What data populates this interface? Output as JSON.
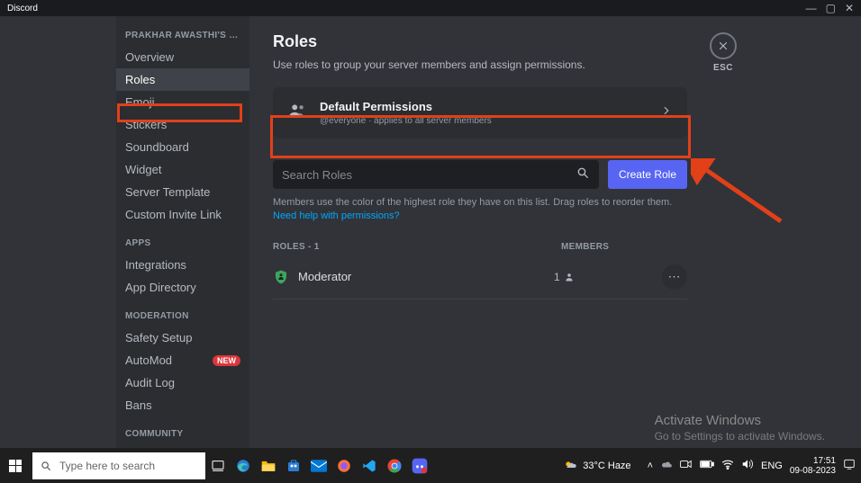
{
  "titlebar": {
    "app_name": "Discord"
  },
  "sidebar": {
    "server_heading": "PRAKHAR AWASTHI'S SERV…",
    "items": [
      {
        "label": "Overview"
      },
      {
        "label": "Roles",
        "selected": true
      },
      {
        "label": "Emoji"
      },
      {
        "label": "Stickers"
      },
      {
        "label": "Soundboard"
      },
      {
        "label": "Widget"
      },
      {
        "label": "Server Template"
      },
      {
        "label": "Custom Invite Link"
      }
    ],
    "apps_heading": "APPS",
    "apps": [
      {
        "label": "Integrations"
      },
      {
        "label": "App Directory"
      }
    ],
    "moderation_heading": "MODERATION",
    "moderation": [
      {
        "label": "Safety Setup"
      },
      {
        "label": "AutoMod",
        "badge": "NEW"
      },
      {
        "label": "Audit Log"
      },
      {
        "label": "Bans"
      }
    ],
    "community_heading": "COMMUNITY"
  },
  "main": {
    "title": "Roles",
    "description": "Use roles to group your server members and assign permissions.",
    "esc_label": "ESC",
    "default_card": {
      "title": "Default Permissions",
      "sub": "@everyone · applies to all server members"
    },
    "search_placeholder": "Search Roles",
    "create_button": "Create Role",
    "help_prefix": "Members use the color of the highest role they have on this list. Drag roles to reorder them. ",
    "help_link": "Need help with permissions?",
    "table": {
      "roles_header": "ROLES - 1",
      "members_header": "MEMBERS"
    },
    "roles": [
      {
        "name": "Moderator",
        "member_count": "1",
        "color": "#3ba55c"
      }
    ]
  },
  "activate": {
    "line1": "Activate Windows",
    "line2": "Go to Settings to activate Windows."
  },
  "taskbar": {
    "search_placeholder": "Type here to search",
    "weather": "33°C Haze",
    "lang": "ENG",
    "time": "17:51",
    "date": "09-08-2023"
  }
}
